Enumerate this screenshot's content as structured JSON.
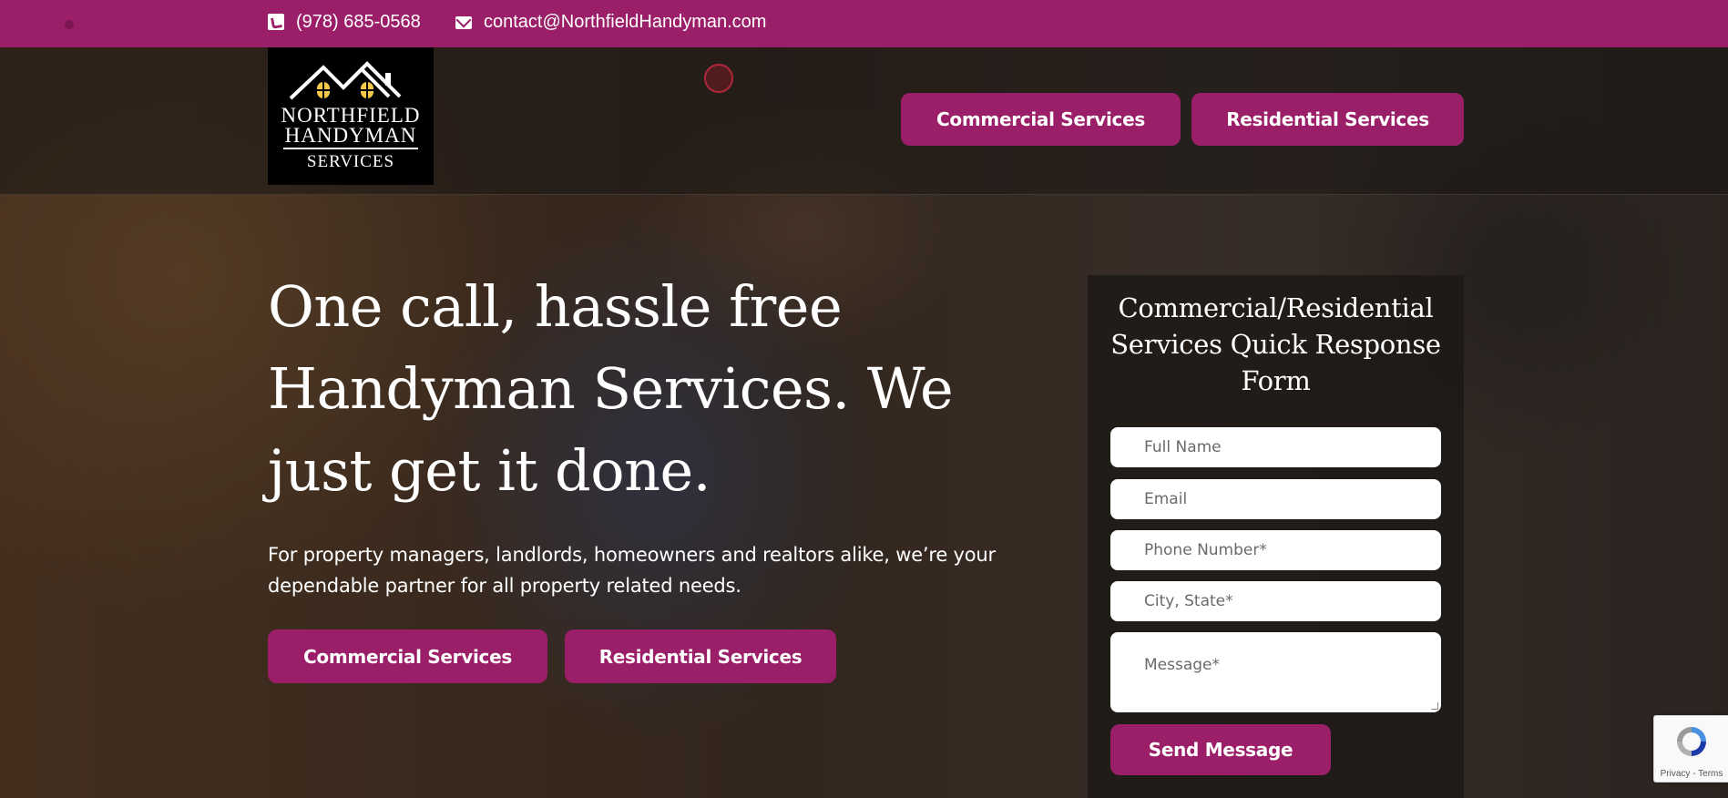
{
  "topbar": {
    "phone": "(978) 685-0568",
    "email": "contact@NorthfieldHandyman.com"
  },
  "logo": {
    "line1": "NORTHFIELD",
    "line2": "HANDYMAN",
    "line3": "SERVICES"
  },
  "nav": {
    "commercial": "Commercial Services",
    "residential": "Residential Services"
  },
  "hero": {
    "headline": "One call, hassle free Handyman Services. We just get it done.",
    "subtext": "For property managers, landlords, homeowners and realtors alike, we’re your dependable partner for all property related needs.",
    "commercial": "Commercial Services",
    "residential": "Residential Services"
  },
  "form": {
    "title": "Commercial/Residential Services Quick Response Form",
    "full_name_placeholder": "Full Name",
    "email_placeholder": "Email",
    "phone_placeholder": "Phone Number*",
    "city_placeholder": "City, State*",
    "message_placeholder": "Message*",
    "submit": "Send Message"
  },
  "recaptcha": {
    "terms": "Privacy - Terms"
  },
  "colors": {
    "brand": "#9b1e68",
    "logo_window": "#f5c84a"
  }
}
